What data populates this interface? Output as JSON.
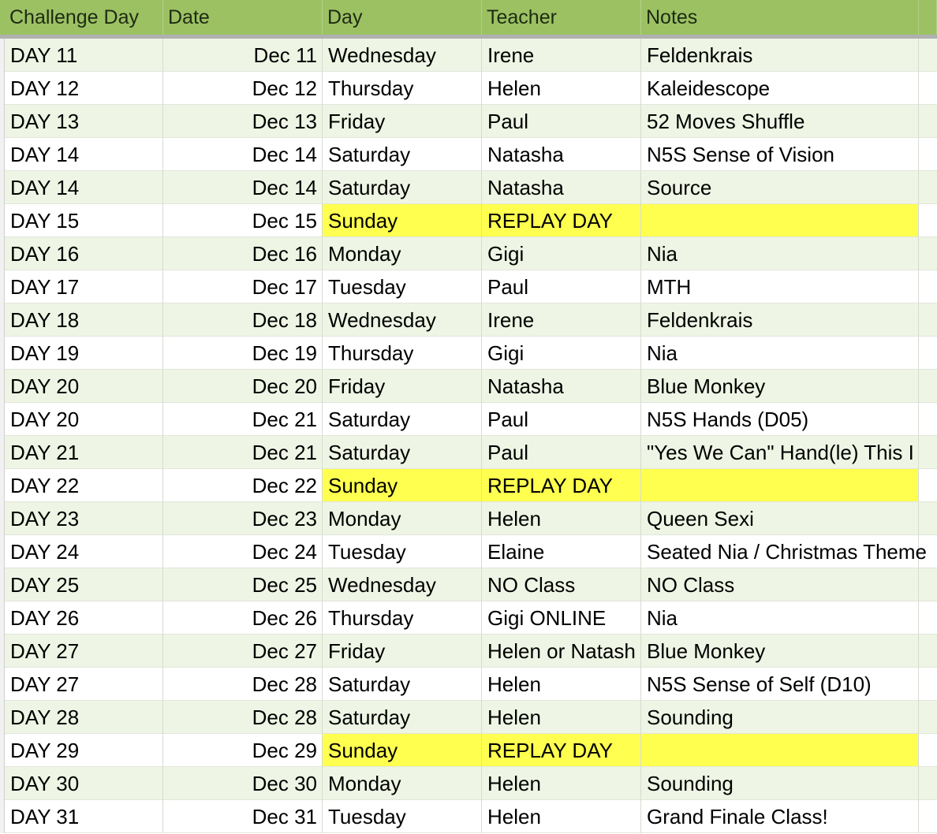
{
  "headers": [
    "Challenge Day",
    "Date",
    "Day",
    "Teacher",
    "Notes"
  ],
  "colors": {
    "header_bg": "#9bc163",
    "band_bg": "#eef5e4",
    "highlight": "#ffff4f"
  },
  "rows": [
    {
      "cells": [
        "DAY 11",
        "Dec 11",
        "Wednesday",
        "Irene",
        "Feldenkrais"
      ]
    },
    {
      "cells": [
        "DAY 12",
        "Dec 12",
        "Thursday",
        "Helen",
        "Kaleidescope"
      ]
    },
    {
      "cells": [
        "DAY 13",
        "Dec 13",
        "Friday",
        "Paul",
        "52 Moves Shuffle"
      ]
    },
    {
      "cells": [
        "DAY 14",
        "Dec 14",
        "Saturday",
        "Natasha",
        "N5S Sense of Vision"
      ]
    },
    {
      "cells": [
        "DAY 14",
        "Dec 14",
        "Saturday",
        "Natasha",
        "Source"
      ]
    },
    {
      "cells": [
        "DAY 15",
        "Dec 15",
        "Sunday",
        "REPLAY DAY",
        ""
      ],
      "highlight": true
    },
    {
      "cells": [
        "DAY 16",
        "Dec 16",
        "Monday",
        "Gigi",
        "Nia"
      ]
    },
    {
      "cells": [
        "DAY 17",
        "Dec 17",
        "Tuesday",
        "Paul",
        "MTH"
      ]
    },
    {
      "cells": [
        "DAY 18",
        "Dec 18",
        "Wednesday",
        "Irene",
        "Feldenkrais"
      ]
    },
    {
      "cells": [
        "DAY 19",
        "Dec 19",
        "Thursday",
        "Gigi",
        "Nia"
      ]
    },
    {
      "cells": [
        "DAY 20",
        "Dec 20",
        "Friday",
        "Natasha",
        "Blue Monkey"
      ]
    },
    {
      "cells": [
        "DAY 20",
        "Dec 21",
        "Saturday",
        "Paul",
        "N5S Hands (D05)"
      ]
    },
    {
      "cells": [
        "DAY 21",
        "Dec 21",
        "Saturday",
        "Paul",
        "\"Yes We Can\" Hand(le) This I"
      ]
    },
    {
      "cells": [
        "DAY 22",
        "Dec 22",
        "Sunday",
        "REPLAY DAY",
        ""
      ],
      "highlight": true
    },
    {
      "cells": [
        "DAY 23",
        "Dec 23",
        "Monday",
        "Helen",
        "Queen Sexi"
      ]
    },
    {
      "cells": [
        "DAY 24",
        "Dec 24",
        "Tuesday",
        "Elaine",
        "Seated Nia / Christmas Theme"
      ],
      "notes_overflow": true
    },
    {
      "cells": [
        "DAY 25",
        "Dec 25",
        "Wednesday",
        "NO Class",
        "NO Class"
      ]
    },
    {
      "cells": [
        "DAY 26",
        "Dec 26",
        "Thursday",
        "Gigi ONLINE",
        " Nia"
      ]
    },
    {
      "cells": [
        "DAY 27",
        "Dec 27",
        "Friday",
        "Helen or Natash",
        "Blue Monkey"
      ]
    },
    {
      "cells": [
        "DAY 27",
        "Dec 28",
        "Saturday",
        "Helen",
        "N5S Sense of Self (D10)"
      ]
    },
    {
      "cells": [
        "DAY 28",
        "Dec 28",
        "Saturday",
        "Helen",
        "Sounding"
      ]
    },
    {
      "cells": [
        "DAY 29",
        "Dec 29",
        "Sunday",
        "REPLAY DAY",
        ""
      ],
      "highlight": true
    },
    {
      "cells": [
        "DAY 30",
        "Dec 30",
        "Monday",
        "Helen",
        "Sounding"
      ]
    },
    {
      "cells": [
        "DAY 31",
        "Dec 31",
        "Tuesday",
        "Helen",
        "Grand Finale Class!"
      ]
    }
  ]
}
